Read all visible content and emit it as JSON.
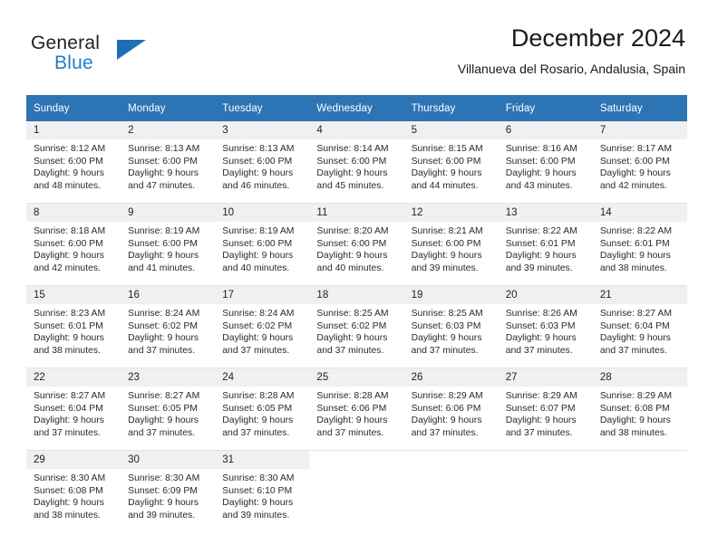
{
  "brand": {
    "name_top": "General",
    "name_bottom": "Blue",
    "triangle_color": "#1d6fb8",
    "blue_color": "#1f7fc4"
  },
  "header": {
    "title": "December 2024",
    "subtitle": "Villanueva del Rosario, Andalusia, Spain"
  },
  "theme": {
    "header_bg": "#2d74b5",
    "daynum_bg": "#f0f0f0",
    "row_separator": "#e3e3e3",
    "text": "#1a1a1a"
  },
  "weekdays": [
    "Sunday",
    "Monday",
    "Tuesday",
    "Wednesday",
    "Thursday",
    "Friday",
    "Saturday"
  ],
  "weeks": [
    [
      {
        "day": "1",
        "sunrise": "Sunrise: 8:12 AM",
        "sunset": "Sunset: 6:00 PM",
        "daylight": "Daylight: 9 hours and 48 minutes."
      },
      {
        "day": "2",
        "sunrise": "Sunrise: 8:13 AM",
        "sunset": "Sunset: 6:00 PM",
        "daylight": "Daylight: 9 hours and 47 minutes."
      },
      {
        "day": "3",
        "sunrise": "Sunrise: 8:13 AM",
        "sunset": "Sunset: 6:00 PM",
        "daylight": "Daylight: 9 hours and 46 minutes."
      },
      {
        "day": "4",
        "sunrise": "Sunrise: 8:14 AM",
        "sunset": "Sunset: 6:00 PM",
        "daylight": "Daylight: 9 hours and 45 minutes."
      },
      {
        "day": "5",
        "sunrise": "Sunrise: 8:15 AM",
        "sunset": "Sunset: 6:00 PM",
        "daylight": "Daylight: 9 hours and 44 minutes."
      },
      {
        "day": "6",
        "sunrise": "Sunrise: 8:16 AM",
        "sunset": "Sunset: 6:00 PM",
        "daylight": "Daylight: 9 hours and 43 minutes."
      },
      {
        "day": "7",
        "sunrise": "Sunrise: 8:17 AM",
        "sunset": "Sunset: 6:00 PM",
        "daylight": "Daylight: 9 hours and 42 minutes."
      }
    ],
    [
      {
        "day": "8",
        "sunrise": "Sunrise: 8:18 AM",
        "sunset": "Sunset: 6:00 PM",
        "daylight": "Daylight: 9 hours and 42 minutes."
      },
      {
        "day": "9",
        "sunrise": "Sunrise: 8:19 AM",
        "sunset": "Sunset: 6:00 PM",
        "daylight": "Daylight: 9 hours and 41 minutes."
      },
      {
        "day": "10",
        "sunrise": "Sunrise: 8:19 AM",
        "sunset": "Sunset: 6:00 PM",
        "daylight": "Daylight: 9 hours and 40 minutes."
      },
      {
        "day": "11",
        "sunrise": "Sunrise: 8:20 AM",
        "sunset": "Sunset: 6:00 PM",
        "daylight": "Daylight: 9 hours and 40 minutes."
      },
      {
        "day": "12",
        "sunrise": "Sunrise: 8:21 AM",
        "sunset": "Sunset: 6:00 PM",
        "daylight": "Daylight: 9 hours and 39 minutes."
      },
      {
        "day": "13",
        "sunrise": "Sunrise: 8:22 AM",
        "sunset": "Sunset: 6:01 PM",
        "daylight": "Daylight: 9 hours and 39 minutes."
      },
      {
        "day": "14",
        "sunrise": "Sunrise: 8:22 AM",
        "sunset": "Sunset: 6:01 PM",
        "daylight": "Daylight: 9 hours and 38 minutes."
      }
    ],
    [
      {
        "day": "15",
        "sunrise": "Sunrise: 8:23 AM",
        "sunset": "Sunset: 6:01 PM",
        "daylight": "Daylight: 9 hours and 38 minutes."
      },
      {
        "day": "16",
        "sunrise": "Sunrise: 8:24 AM",
        "sunset": "Sunset: 6:02 PM",
        "daylight": "Daylight: 9 hours and 37 minutes."
      },
      {
        "day": "17",
        "sunrise": "Sunrise: 8:24 AM",
        "sunset": "Sunset: 6:02 PM",
        "daylight": "Daylight: 9 hours and 37 minutes."
      },
      {
        "day": "18",
        "sunrise": "Sunrise: 8:25 AM",
        "sunset": "Sunset: 6:02 PM",
        "daylight": "Daylight: 9 hours and 37 minutes."
      },
      {
        "day": "19",
        "sunrise": "Sunrise: 8:25 AM",
        "sunset": "Sunset: 6:03 PM",
        "daylight": "Daylight: 9 hours and 37 minutes."
      },
      {
        "day": "20",
        "sunrise": "Sunrise: 8:26 AM",
        "sunset": "Sunset: 6:03 PM",
        "daylight": "Daylight: 9 hours and 37 minutes."
      },
      {
        "day": "21",
        "sunrise": "Sunrise: 8:27 AM",
        "sunset": "Sunset: 6:04 PM",
        "daylight": "Daylight: 9 hours and 37 minutes."
      }
    ],
    [
      {
        "day": "22",
        "sunrise": "Sunrise: 8:27 AM",
        "sunset": "Sunset: 6:04 PM",
        "daylight": "Daylight: 9 hours and 37 minutes."
      },
      {
        "day": "23",
        "sunrise": "Sunrise: 8:27 AM",
        "sunset": "Sunset: 6:05 PM",
        "daylight": "Daylight: 9 hours and 37 minutes."
      },
      {
        "day": "24",
        "sunrise": "Sunrise: 8:28 AM",
        "sunset": "Sunset: 6:05 PM",
        "daylight": "Daylight: 9 hours and 37 minutes."
      },
      {
        "day": "25",
        "sunrise": "Sunrise: 8:28 AM",
        "sunset": "Sunset: 6:06 PM",
        "daylight": "Daylight: 9 hours and 37 minutes."
      },
      {
        "day": "26",
        "sunrise": "Sunrise: 8:29 AM",
        "sunset": "Sunset: 6:06 PM",
        "daylight": "Daylight: 9 hours and 37 minutes."
      },
      {
        "day": "27",
        "sunrise": "Sunrise: 8:29 AM",
        "sunset": "Sunset: 6:07 PM",
        "daylight": "Daylight: 9 hours and 37 minutes."
      },
      {
        "day": "28",
        "sunrise": "Sunrise: 8:29 AM",
        "sunset": "Sunset: 6:08 PM",
        "daylight": "Daylight: 9 hours and 38 minutes."
      }
    ],
    [
      {
        "day": "29",
        "sunrise": "Sunrise: 8:30 AM",
        "sunset": "Sunset: 6:08 PM",
        "daylight": "Daylight: 9 hours and 38 minutes."
      },
      {
        "day": "30",
        "sunrise": "Sunrise: 8:30 AM",
        "sunset": "Sunset: 6:09 PM",
        "daylight": "Daylight: 9 hours and 39 minutes."
      },
      {
        "day": "31",
        "sunrise": "Sunrise: 8:30 AM",
        "sunset": "Sunset: 6:10 PM",
        "daylight": "Daylight: 9 hours and 39 minutes."
      },
      {
        "day": "",
        "sunrise": "",
        "sunset": "",
        "daylight": ""
      },
      {
        "day": "",
        "sunrise": "",
        "sunset": "",
        "daylight": ""
      },
      {
        "day": "",
        "sunrise": "",
        "sunset": "",
        "daylight": ""
      },
      {
        "day": "",
        "sunrise": "",
        "sunset": "",
        "daylight": ""
      }
    ]
  ]
}
